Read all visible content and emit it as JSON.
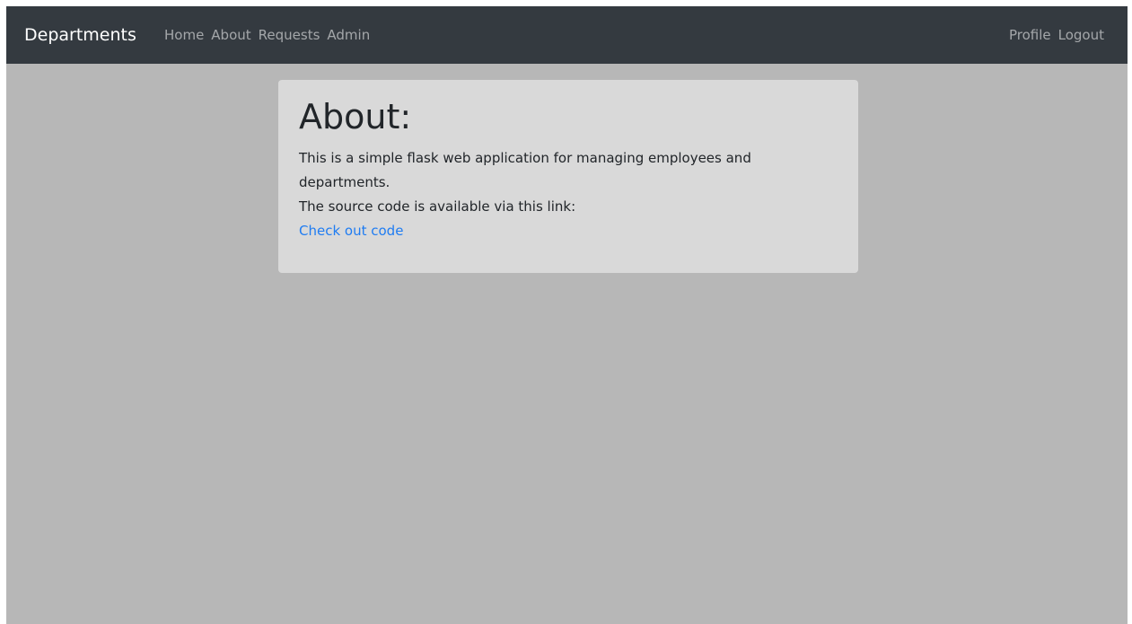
{
  "navbar": {
    "brand": "Departments",
    "left_links": [
      {
        "label": "Home"
      },
      {
        "label": "About"
      },
      {
        "label": "Requests"
      },
      {
        "label": "Admin"
      }
    ],
    "right_links": [
      {
        "label": "Profile"
      },
      {
        "label": "Logout"
      }
    ]
  },
  "content": {
    "title": "About:",
    "line1": "This is a simple flask web application for managing employees and departments.",
    "line2": "The source code is available via this link:",
    "link_label": "Check out code"
  },
  "colors": {
    "navbar_bg": "#343a40",
    "page_bg": "#b7b7b7",
    "card_bg": "#d9d9d9",
    "link": "#1f7cf2"
  }
}
